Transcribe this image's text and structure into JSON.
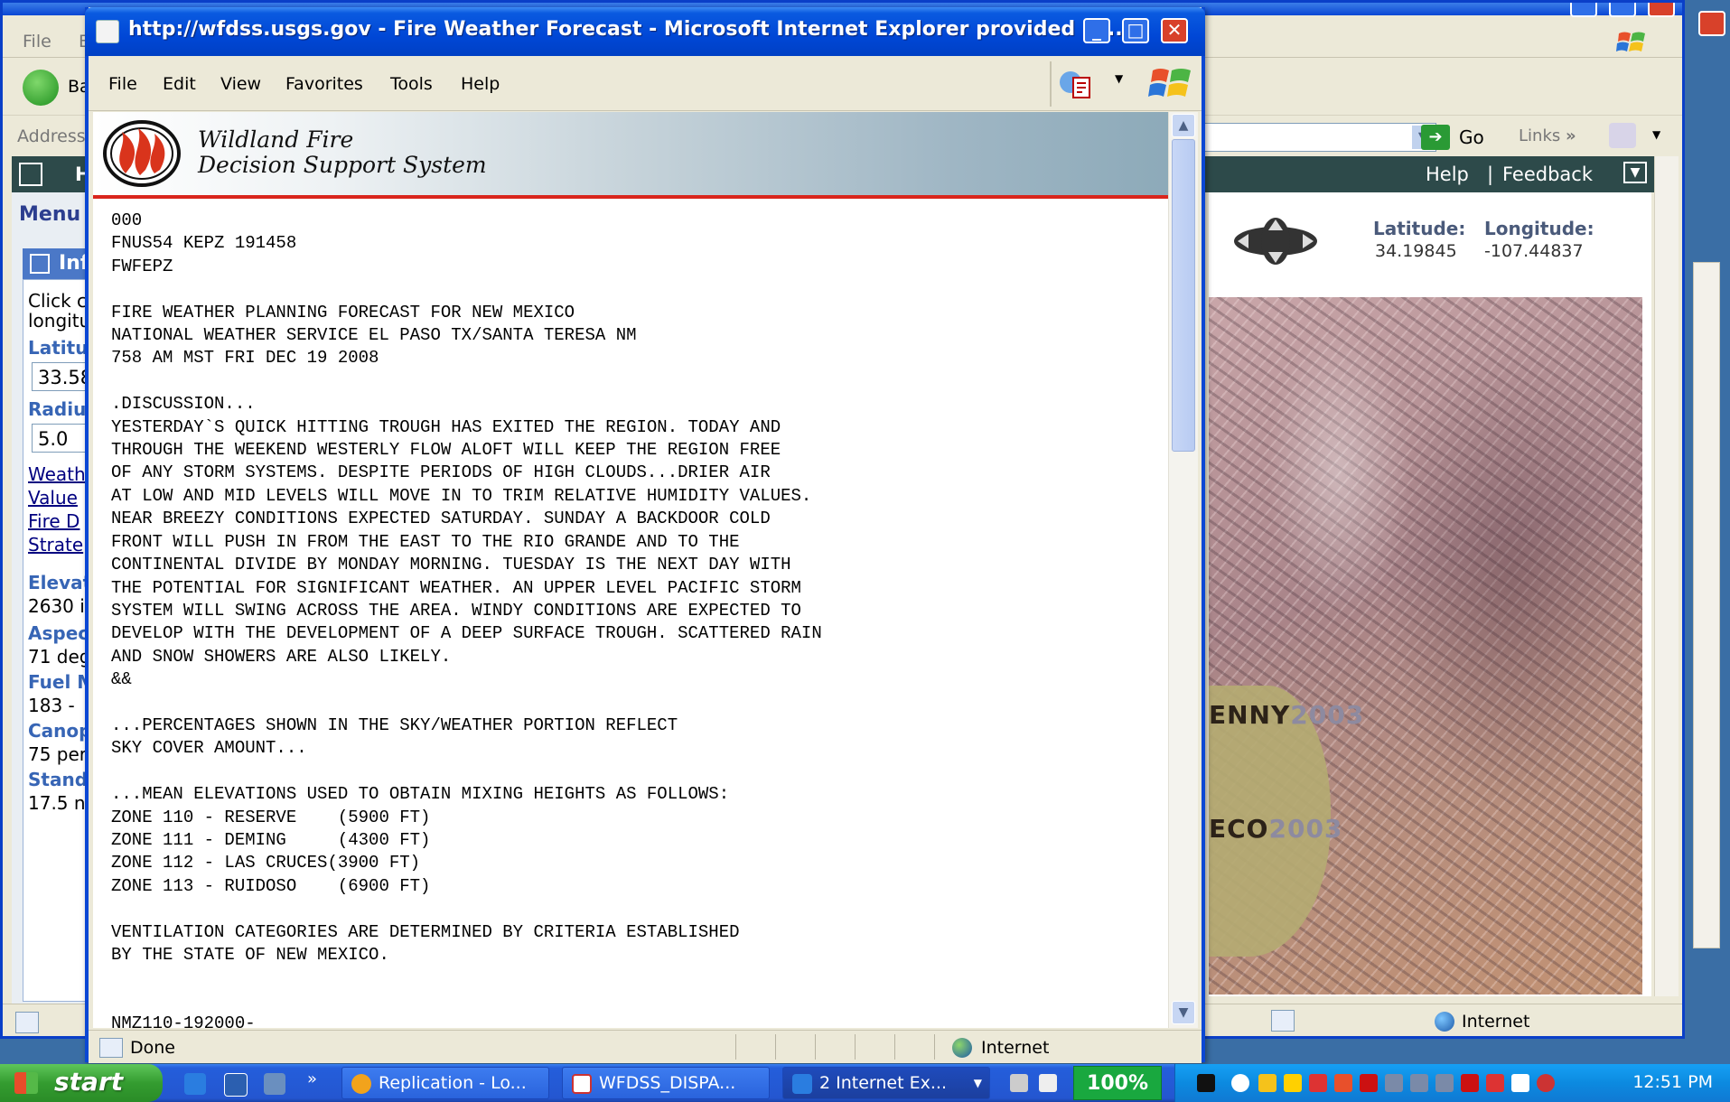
{
  "background_window": {
    "menu": [
      "File",
      "E"
    ],
    "back_label": "Ba",
    "address_label": "Address",
    "go_label": "Go",
    "links_label": "Links",
    "links_chevron": "»",
    "appbar": {
      "h_label": "H",
      "help": "Help",
      "separator": "|",
      "feedback": "Feedback"
    },
    "left_panel": {
      "menu_label": "Menu",
      "info_header": "Inf",
      "click_text_1": "Click c",
      "click_text_2": "longitu",
      "latitude_label": "Latitu",
      "latitude_value": "33.58",
      "radius_label": "Radiu",
      "radius_value": "5.0",
      "links": [
        "Weath",
        "Value",
        "Fire D",
        "Strate"
      ],
      "elevation_label": "Elevat",
      "elevation_value": "2630 i",
      "aspect_label": "Aspec",
      "aspect_value": "71 deg",
      "fuel_label": "Fuel M",
      "fuel_value": "183 -",
      "canopy_label": "Canop",
      "canopy_value": "75 per",
      "stand_label": "Stand",
      "stand_value": "17.5 n"
    },
    "map_panel": {
      "latitude_label": "Latitude:",
      "longitude_label": "Longitude:",
      "latitude_value": "34.19845",
      "longitude_value": "-107.44837",
      "fire_labels": [
        {
          "name": "ENNY",
          "year": "2003"
        },
        {
          "name": "ECO",
          "year": "2003"
        }
      ]
    },
    "status_internet": "Internet"
  },
  "popup_window": {
    "title": "http://wfdss.usgs.gov - Fire Weather Forecast - Microsoft Internet Explorer provided by...",
    "menu": [
      "File",
      "Edit",
      "View",
      "Favorites",
      "Tools",
      "Help"
    ],
    "header": {
      "line1": "Wildland Fire",
      "line2": "Decision Support System"
    },
    "forecast_text": "000\nFNUS54 KEPZ 191458\nFWFEPZ\n\nFIRE WEATHER PLANNING FORECAST FOR NEW MEXICO\nNATIONAL WEATHER SERVICE EL PASO TX/SANTA TERESA NM\n758 AM MST FRI DEC 19 2008\n\n.DISCUSSION...\nYESTERDAY`S QUICK HITTING TROUGH HAS EXITED THE REGION. TODAY AND\nTHROUGH THE WEEKEND WESTERLY FLOW ALOFT WILL KEEP THE REGION FREE\nOF ANY STORM SYSTEMS. DESPITE PERIODS OF HIGH CLOUDS...DRIER AIR\nAT LOW AND MID LEVELS WILL MOVE IN TO TRIM RELATIVE HUMIDITY VALUES.\nNEAR BREEZY CONDITIONS EXPECTED SATURDAY. SUNDAY A BACKDOOR COLD\nFRONT WILL PUSH IN FROM THE EAST TO THE RIO GRANDE AND TO THE\nCONTINENTAL DIVIDE BY MONDAY MORNING. TUESDAY IS THE NEXT DAY WITH\nTHE POTENTIAL FOR SIGNIFICANT WEATHER. AN UPPER LEVEL PACIFIC STORM\nSYSTEM WILL SWING ACROSS THE AREA. WINDY CONDITIONS ARE EXPECTED TO\nDEVELOP WITH THE DEVELOPMENT OF A DEEP SURFACE TROUGH. SCATTERED RAIN\nAND SNOW SHOWERS ARE ALSO LIKELY.\n&&\n\n...PERCENTAGES SHOWN IN THE SKY/WEATHER PORTION REFLECT\nSKY COVER AMOUNT...\n\n...MEAN ELEVATIONS USED TO OBTAIN MIXING HEIGHTS AS FOLLOWS:\nZONE 110 - RESERVE    (5900 FT)\nZONE 111 - DEMING     (4300 FT)\nZONE 112 - LAS CRUCES(3900 FT)\nZONE 113 - RUIDOSO    (6900 FT)\n\nVENTILATION CATEGORIES ARE DETERMINED BY CRITERIA ESTABLISHED\nBY THE STATE OF NEW MEXICO.\n\n\nNMZ110-192000-",
    "status_done": "Done",
    "status_internet": "Internet"
  },
  "taskbar": {
    "start_label": "start",
    "quicklaunch_chevron": "»",
    "tasks": [
      {
        "label": "Replication - Lo..."
      },
      {
        "label": "WFDSS_DISPA..."
      },
      {
        "label": "2 Internet Ex..."
      }
    ],
    "zoom": "100%",
    "clock": "12:51 PM"
  }
}
